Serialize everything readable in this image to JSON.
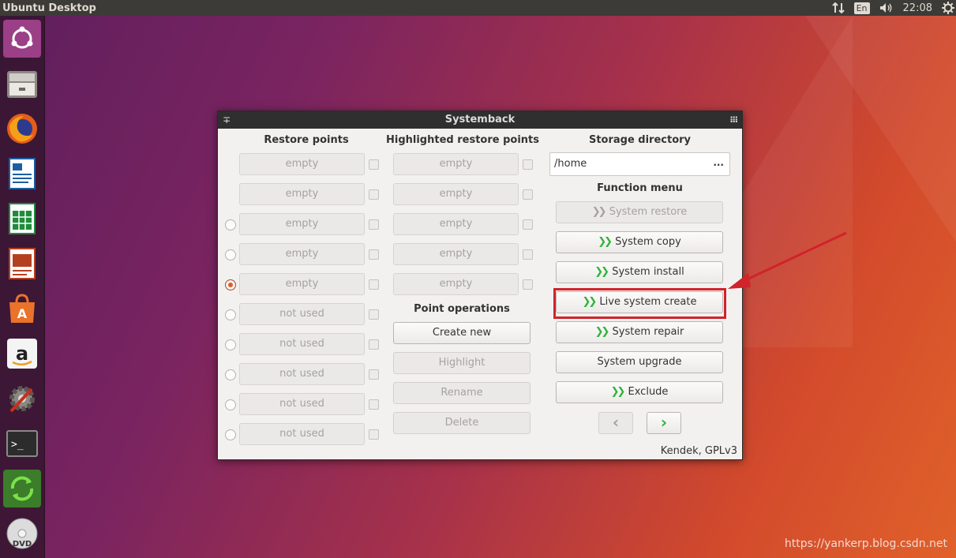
{
  "top_panel": {
    "title": "Ubuntu Desktop",
    "language": "En",
    "time": "22:08"
  },
  "launcher": {
    "items": [
      {
        "name": "ubuntu-dash-icon"
      },
      {
        "name": "files-icon"
      },
      {
        "name": "firefox-icon"
      },
      {
        "name": "writer-icon"
      },
      {
        "name": "calc-icon"
      },
      {
        "name": "impress-icon"
      },
      {
        "name": "software-center-icon"
      },
      {
        "name": "amazon-icon"
      },
      {
        "name": "system-settings-icon"
      },
      {
        "name": "terminal-icon"
      },
      {
        "name": "systemback-icon"
      },
      {
        "name": "dvd-icon"
      }
    ]
  },
  "window": {
    "title": "Systemback",
    "restore_points_header": "Restore points",
    "highlighted_header": "Highlighted restore points",
    "storage_header": "Storage directory",
    "storage_path": "/home",
    "storage_browse": "...",
    "function_menu_header": "Function menu",
    "point_operations_header": "Point operations",
    "restore_points": [
      "empty",
      "empty",
      "empty",
      "empty",
      "empty",
      "not used",
      "not used",
      "not used",
      "not used",
      "not used"
    ],
    "highlighted_points": [
      "empty",
      "empty",
      "empty",
      "empty",
      "empty"
    ],
    "point_operations": {
      "create_new": "Create new",
      "highlight": "Highlight",
      "rename": "Rename",
      "delete": "Delete"
    },
    "functions": {
      "system_restore": "System restore",
      "system_copy": "System copy",
      "system_install": "System install",
      "live_system_create": "Live system create",
      "system_repair": "System repair",
      "system_upgrade": "System upgrade",
      "exclude": "Exclude"
    },
    "footer": "Kendek, GPLv3"
  },
  "watermark": "https://yankerp.blog.csdn.net",
  "colors": {
    "accent_arrow": "#2fb33b",
    "annotation": "#d0232a",
    "radio_selected": "#e05f22"
  }
}
